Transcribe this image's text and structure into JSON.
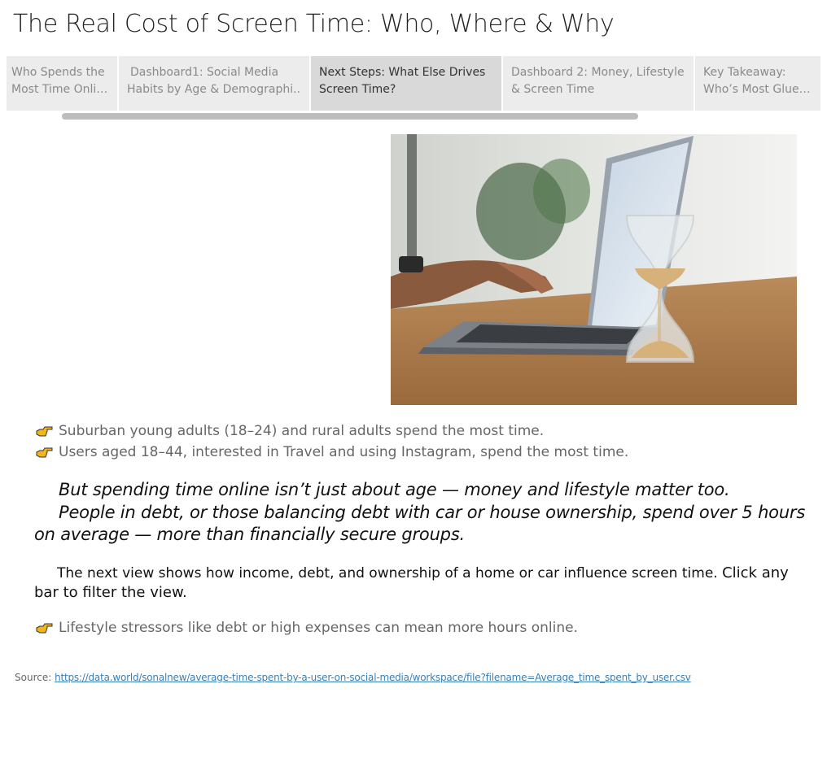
{
  "page": {
    "title": "The Real Cost of Screen Time: Who, Where & Why"
  },
  "tabs": [
    {
      "label": "Who Spends the Most Time Onlin..",
      "line1": "Who Spends the",
      "line2": "Most Time Onlin..",
      "active": false
    },
    {
      "label": "Dashboard1: Social Media Habits by Age & Demographi..",
      "line1": "Dashboard1: Social Media",
      "line2": "Habits by Age & Demographi..",
      "active": false
    },
    {
      "label": "Next Steps: What Else Drives Screen Time?",
      "line1": "Next Steps: What Else Drives",
      "line2": "Screen Time?",
      "active": true
    },
    {
      "label": "Dashboard 2: Money, Lifestyle & Screen Time",
      "line1": "Dashboard 2: Money, Lifestyle",
      "line2": "& Screen Time",
      "active": false
    },
    {
      "label": "Key Takeaway: Who's Most Glued ..",
      "line1": "Key Takeaway:",
      "line2": "Who’s Most Glued ..",
      "active": false
    }
  ],
  "bullets": [
    "Suburban young adults (18–24) and rural adults spend the most time.",
    "Users aged 18–44, interested in Travel and using Instagram, spend the most time."
  ],
  "italic": {
    "line1": "But spending time online isn’t just about age — money and lifestyle matter too.",
    "line2": "People in debt, or those balancing debt with car or house ownership, spend over 5 hours",
    "line3": "on average — more than financially secure groups."
  },
  "paragraph": {
    "main": "The next view shows how income, debt, and ownership of a home or car influence screen time.",
    "cta": "Click any bar to filter the view."
  },
  "bullet3": "Lifestyle stressors like debt or high expenses can mean more hours online.",
  "source": {
    "label": "Source:",
    "link": "https://data.world/sonalnew/average-time-spent-by-a-user-on-social-media/workspace/file?filename=Average_time_spent_by_user.csv"
  },
  "icons": {
    "bullet": "pointing-hand-icon"
  },
  "colors": {
    "active_tab": "#d9d9d9",
    "tab": "#ececec",
    "link": "#3a7fb6",
    "hand": "#f2b51c"
  }
}
